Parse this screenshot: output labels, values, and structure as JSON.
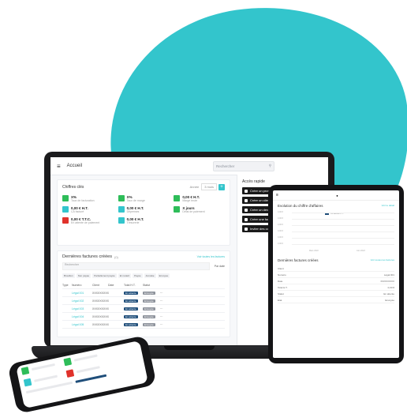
{
  "colors": {
    "accent": "#33c5cc",
    "dark_blue": "#1f4e7a",
    "green": "#2ebd59",
    "red": "#e0322b"
  },
  "laptop": {
    "title": "Accueil",
    "search_placeholder": "Rechercher",
    "kpi": {
      "title": "Chiffres clés",
      "period_label": "Année",
      "period_value": "3 mois",
      "items": [
        {
          "value": "X%",
          "label": "Taux de facturation",
          "color": "#2ebd59",
          "icon": "percent-icon"
        },
        {
          "value": "X%",
          "label": "Taux de marge",
          "color": "#2ebd59",
          "icon": "percent-icon"
        },
        {
          "value": "0,00 € H.T.",
          "label": "Marge brute",
          "color": "#2ebd59",
          "icon": "euro-icon"
        },
        {
          "value": "0,00 € H.T.",
          "label": "CA facturé",
          "color": "#33c5cc",
          "icon": "euro-icon"
        },
        {
          "value": "0,00 € H.T.",
          "label": "Dépenses",
          "color": "#33c5cc",
          "icon": "euro-icon"
        },
        {
          "value": "X jours",
          "label": "Délai de paiement",
          "color": "#2ebd59",
          "icon": "clock-icon"
        },
        {
          "value": "0,00 € T.T.C.",
          "label": "En attente de paiement",
          "color": "#e0322b",
          "icon": "euro-icon"
        },
        {
          "value": "0,00 € H.T.",
          "label": "Trésorerie",
          "color": "#33c5cc",
          "icon": "euro-icon"
        }
      ]
    },
    "invoices": {
      "title": "Dernières factures créées",
      "count": "(0)",
      "see_all": "Voir toutes les factures",
      "search_placeholder": "Rechercher",
      "sort_label": "Par date",
      "filters": [
        "Brouillon",
        "Non payée",
        "Partiellement payée",
        "En retard",
        "Payée",
        "Annulée",
        "Envoyée"
      ],
      "columns": [
        "Type",
        "Numéro",
        "Client",
        "Date",
        "Total H.T.",
        "Statut",
        ""
      ],
      "rows": [
        {
          "type": "",
          "number": "Légal 001",
          "client": "XXXXXXXXX",
          "date": "",
          "total": "",
          "status": "En attente",
          "state": "Envoyée"
        },
        {
          "type": "",
          "number": "Légal 002",
          "client": "XXXXXXXXX",
          "date": "",
          "total": "",
          "status": "En attente",
          "state": "Envoyée"
        },
        {
          "type": "",
          "number": "Légal 003",
          "client": "XXXXXXXXX",
          "date": "",
          "total": "",
          "status": "En attente",
          "state": "Envoyée"
        },
        {
          "type": "",
          "number": "Légal 004",
          "client": "XXXXXXXXX",
          "date": "",
          "total": "",
          "status": "En attente",
          "state": "Envoyée"
        },
        {
          "type": "",
          "number": "Légal 005",
          "client": "XXXXXXXXX",
          "date": "",
          "total": "",
          "status": "En attente",
          "state": "Envoyée"
        }
      ]
    },
    "quick_access": {
      "title": "Accès rapide",
      "items": [
        "Créer un prospect",
        "Créer un client",
        "Créer un devis",
        "Créer une facture",
        "Inviter des collaborateurs"
      ]
    }
  },
  "tablet": {
    "chart_title": "Evolution du chiffre d'affaires",
    "chart_link": "Voir le détail",
    "legend": "CA facturé H.T.",
    "y_ticks": [
      "0,00 €",
      "0,00 €",
      "0,00 €",
      "0,00 €",
      "0,00 €",
      "0,00 €"
    ],
    "x_ticks": [
      "Mars 2022",
      "Juin 2022"
    ],
    "invoices_title": "Dernières factures créées",
    "invoices_link": "Voir toutes les factures",
    "rows": [
      {
        "label": "Client",
        "value": ""
      },
      {
        "label": "Numéro",
        "value": "Légal 001"
      },
      {
        "label": "Date",
        "value": "XX/XX/XXXX"
      },
      {
        "label": "Total H.T.",
        "value": "0,00 €"
      },
      {
        "label": "Statut",
        "value": "En attente"
      },
      {
        "label": "Etat",
        "value": "Envoyée"
      }
    ]
  }
}
